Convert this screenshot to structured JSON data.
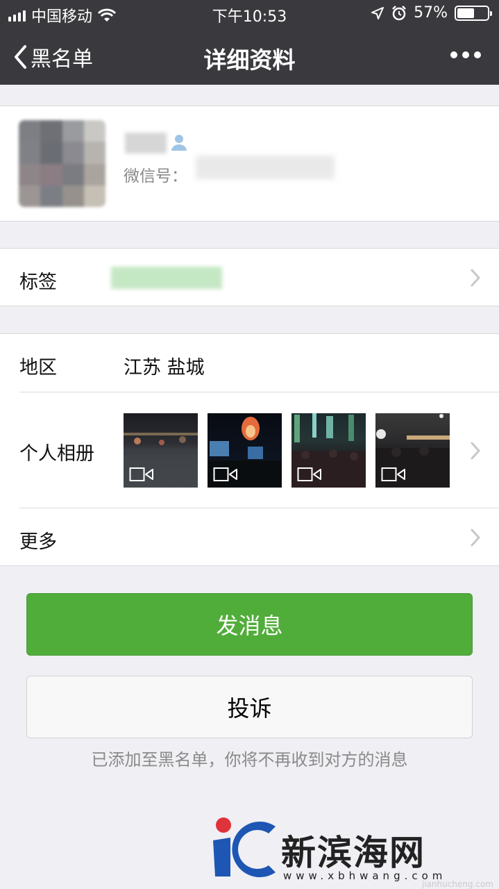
{
  "status_bar": {
    "carrier": "中国移动",
    "time": "下午10:53",
    "battery_text": "57%",
    "battery_level": 0.57
  },
  "navbar": {
    "back_label": "黑名单",
    "title": "详细资料"
  },
  "profile": {
    "wechat_id_label": "微信号："
  },
  "tags_row": {
    "label": "标签"
  },
  "region_row": {
    "label": "地区",
    "value": "江苏 盐城"
  },
  "album_row": {
    "label": "个人相册"
  },
  "more_row": {
    "label": "更多"
  },
  "buttons": {
    "send_message": "发消息",
    "report": "投诉"
  },
  "blacklist_note": "已添加至黑名单，你将不再收到对方的消息",
  "watermark": {
    "name": "新滨海网",
    "url": "www.xbhwang.com",
    "url2": "jianhucheng.com"
  },
  "colors": {
    "header_bg": "#3a3a3e",
    "page_bg": "#efeff4",
    "primary_green": "#51ad3a",
    "note_gray": "#8a8a8a"
  }
}
